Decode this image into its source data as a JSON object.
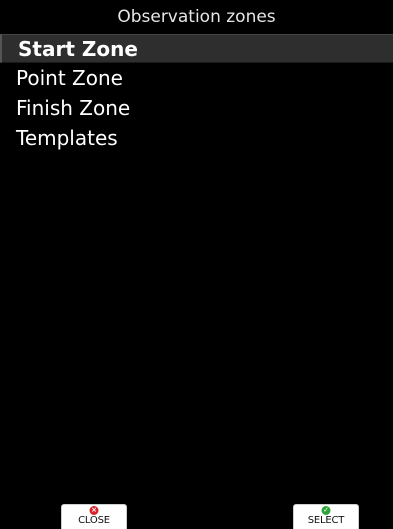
{
  "window": {
    "title": "Observation zones"
  },
  "menu": {
    "items": [
      {
        "label": "Start Zone",
        "selected": true
      },
      {
        "label": "Point Zone",
        "selected": false
      },
      {
        "label": "Finish Zone",
        "selected": false
      },
      {
        "label": "Templates",
        "selected": false
      }
    ]
  },
  "softkeys": {
    "close": {
      "label": "CLOSE",
      "icon": "x-icon",
      "color": "#d8232a"
    },
    "select": {
      "label": "SELECT",
      "icon": "check-icon",
      "color": "#2fa33a"
    }
  }
}
